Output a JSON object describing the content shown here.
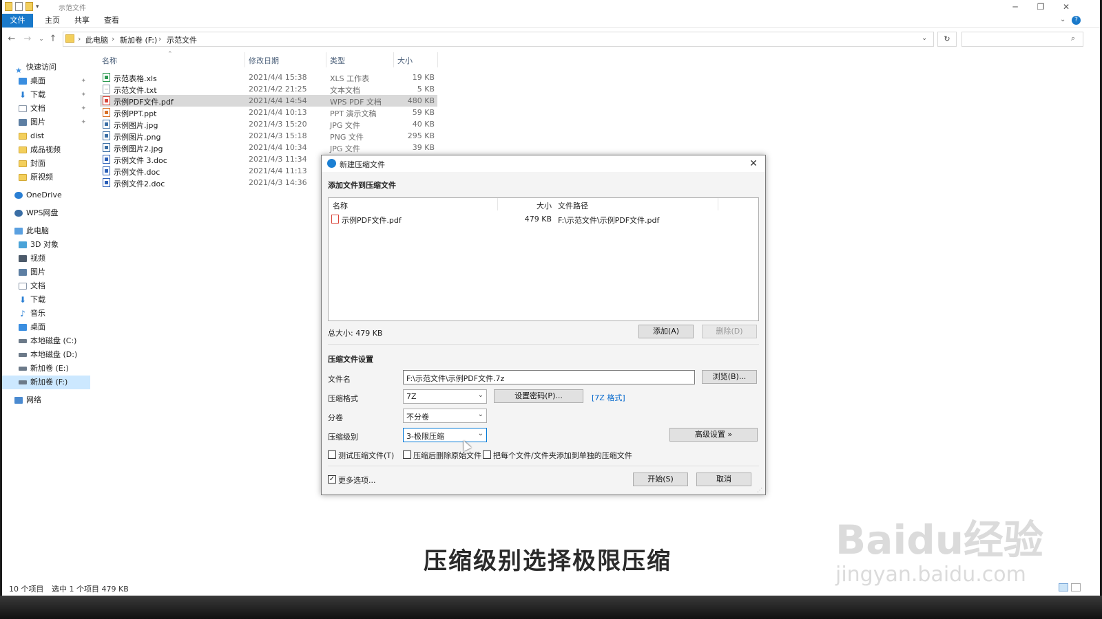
{
  "window": {
    "title": "示范文件",
    "tabs": [
      "文件",
      "主页",
      "共享",
      "查看"
    ]
  },
  "address": {
    "crumbs": [
      "此电脑",
      "新加卷 (F:)",
      "示范文件"
    ]
  },
  "nav": {
    "items": [
      {
        "label": "快速访问",
        "icon": "star-icon"
      },
      {
        "label": "桌面",
        "icon": "desktop-icon",
        "pinned": true
      },
      {
        "label": "下载",
        "icon": "download-icon",
        "pinned": true
      },
      {
        "label": "文档",
        "icon": "document-icon",
        "pinned": true
      },
      {
        "label": "图片",
        "icon": "picture-icon",
        "pinned": true
      },
      {
        "label": "dist",
        "icon": "folder-icon"
      },
      {
        "label": "成品视频",
        "icon": "folder-icon"
      },
      {
        "label": "封面",
        "icon": "folder-icon"
      },
      {
        "label": "原视频",
        "icon": "folder-icon"
      },
      {
        "label": "OneDrive",
        "icon": "cloud-icon"
      },
      {
        "label": "WPS网盘",
        "icon": "cloud-icon"
      },
      {
        "label": "此电脑",
        "icon": "computer-icon"
      },
      {
        "label": "3D 对象",
        "icon": "3d-objects-icon"
      },
      {
        "label": "视频",
        "icon": "video-icon"
      },
      {
        "label": "图片",
        "icon": "picture-icon"
      },
      {
        "label": "文档",
        "icon": "document-icon"
      },
      {
        "label": "下载",
        "icon": "download-icon"
      },
      {
        "label": "音乐",
        "icon": "music-icon"
      },
      {
        "label": "桌面",
        "icon": "desktop-icon"
      },
      {
        "label": "本地磁盘 (C:)",
        "icon": "drive-icon"
      },
      {
        "label": "本地磁盘 (D:)",
        "icon": "drive-icon"
      },
      {
        "label": "新加卷 (E:)",
        "icon": "drive-icon"
      },
      {
        "label": "新加卷 (F:)",
        "icon": "drive-icon",
        "selected": true
      },
      {
        "label": "网络",
        "icon": "network-icon"
      }
    ]
  },
  "files": {
    "headers": {
      "name": "名称",
      "date": "修改日期",
      "type": "类型",
      "size": "大小"
    },
    "rows": [
      {
        "name": "示范表格.xls",
        "date": "2021/4/4 15:38",
        "type": "XLS 工作表",
        "size": "19 KB",
        "icon": "xls"
      },
      {
        "name": "示范文件.txt",
        "date": "2021/4/2 21:25",
        "type": "文本文档",
        "size": "5 KB",
        "icon": "txt"
      },
      {
        "name": "示例PDF文件.pdf",
        "date": "2021/4/4 14:54",
        "type": "WPS PDF 文档",
        "size": "480 KB",
        "icon": "pdf",
        "selected": true
      },
      {
        "name": "示例PPT.ppt",
        "date": "2021/4/4 10:13",
        "type": "PPT 演示文稿",
        "size": "59 KB",
        "icon": "ppt"
      },
      {
        "name": "示例图片.jpg",
        "date": "2021/4/3 15:20",
        "type": "JPG 文件",
        "size": "40 KB",
        "icon": "img"
      },
      {
        "name": "示例图片.png",
        "date": "2021/4/3 15:18",
        "type": "PNG 文件",
        "size": "295 KB",
        "icon": "img"
      },
      {
        "name": "示例图片2.jpg",
        "date": "2021/4/4 10:34",
        "type": "JPG 文件",
        "size": "39 KB",
        "icon": "img"
      },
      {
        "name": "示例文件 3.doc",
        "date": "2021/4/3 11:34",
        "type": "",
        "size": "",
        "icon": "doc"
      },
      {
        "name": "示例文件.doc",
        "date": "2021/4/4 11:13",
        "type": "",
        "size": "",
        "icon": "doc"
      },
      {
        "name": "示例文件2.doc",
        "date": "2021/4/3 14:36",
        "type": "",
        "size": "",
        "icon": "doc"
      }
    ]
  },
  "status": {
    "count": "10 个项目",
    "selection": "选中 1 个项目  479 KB"
  },
  "dialog": {
    "title": "新建压缩文件",
    "add_section": "添加文件到压缩文件",
    "list_headers": {
      "name": "名称",
      "size": "大小",
      "path": "文件路径"
    },
    "list_row": {
      "name": "示例PDF文件.pdf",
      "size": "479 KB",
      "path": "F:\\示范文件\\示例PDF文件.pdf"
    },
    "total": "总大小: 479 KB",
    "add_button": "添加(A)",
    "delete_button": "删除(D)",
    "settings_section": "压缩文件设置",
    "filename_label": "文件名",
    "filename_value": "F:\\示范文件\\示例PDF文件.7z",
    "browse_button": "浏览(B)...",
    "format_label": "压缩格式",
    "format_value": "7Z",
    "password_button": "设置密码(P)...",
    "format_link": "[7Z 格式]",
    "volume_label": "分卷",
    "volume_value": "不分卷",
    "level_label": "压缩级别",
    "level_value": "3-极限压缩",
    "advanced_button": "高级设置 »",
    "opt_test": "测试压缩文件(T)",
    "opt_delete": "压缩后删除原始文件",
    "opt_each": "把每个文件/文件夹添加到单独的压缩文件",
    "more_options": "更多选项...",
    "start_button": "开始(S)",
    "cancel_button": "取消"
  },
  "subtitle": "压缩级别选择极限压缩",
  "watermark": {
    "line1": "Baidu经验",
    "line2": "jingyan.baidu.com"
  }
}
